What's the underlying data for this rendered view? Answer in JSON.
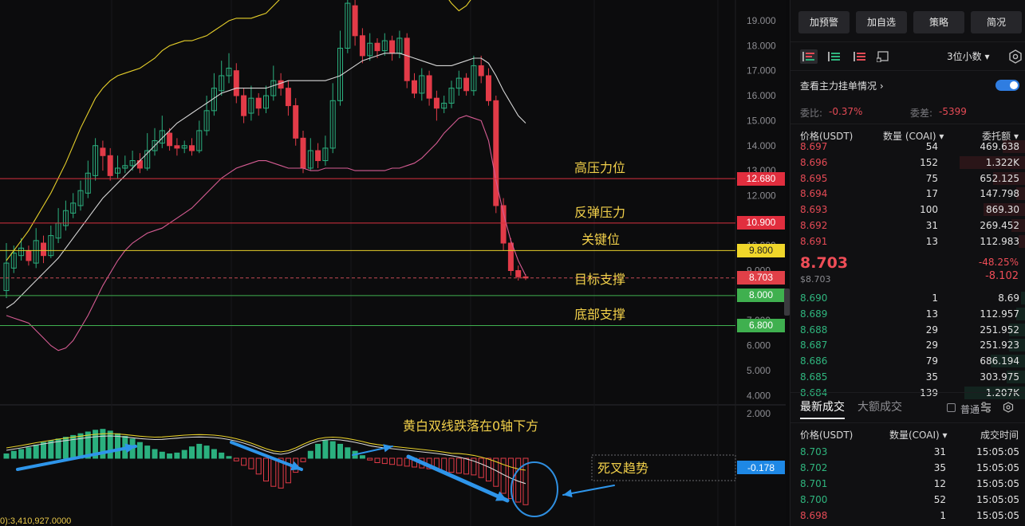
{
  "chart": {
    "price_axis": [
      "19.000",
      "18.000",
      "17.000",
      "16.000",
      "15.000",
      "14.000",
      "13.000",
      "12.000",
      "11.000",
      "10.000",
      "9.000",
      "8.000",
      "7.000",
      "6.000",
      "5.000",
      "4.000"
    ],
    "macd_axis": [
      "2.000"
    ],
    "levels": [
      {
        "value": "12.680",
        "color": "#e12e3e",
        "line": "#d8313f",
        "annotation": "高压力位"
      },
      {
        "value": "10.900",
        "color": "#e12e3e",
        "line": "#d8313f",
        "annotation": "反弹压力"
      },
      {
        "value": "9.800",
        "color": "#f0d62a",
        "line": "#e6cf2a",
        "annotation": "关键位"
      },
      {
        "value": "8.703",
        "color": "#e04048",
        "line": "#c44a54",
        "annotation": "目标支撑"
      },
      {
        "value": "8.000",
        "color": "#3fb04f",
        "line": "#3fb04f",
        "annotation": ""
      },
      {
        "value": "6.800",
        "color": "#3fb04f",
        "line": "#3fb04f",
        "annotation": "底部支撑"
      }
    ],
    "macd_value": "-0.178",
    "macd_annotation": "黄白双线跌落在0轴下方",
    "death_cross_annotation": "死叉趋势",
    "volume_caption": "0):3,410,927.0000",
    "colors": {
      "up": "#2bb07f",
      "down": "#e23b48",
      "macd_label": "#1e88e5"
    }
  },
  "panel": {
    "top_buttons": [
      "加预警",
      "加自选",
      "策略",
      "简况"
    ],
    "mode_icons": [
      "orderbook-both-icon",
      "orderbook-bids-icon",
      "orderbook-asks-icon",
      "orderbook-expand-icon"
    ],
    "decimal_select": "3位小数 ▾",
    "mainforce_link": "查看主力挂单情况 ›",
    "ratio_label": "委比:",
    "ratio_value": "-0.37%",
    "diff_label": "委差:",
    "diff_value": "-5399",
    "orderbook_headers": {
      "price": "价格(USDT)",
      "qty": "数量 (COAI) ▾",
      "amount": "委托额 ▾"
    },
    "asks": [
      {
        "price": "8.697",
        "qty": "54",
        "amount": "469.638",
        "depth": 0.1
      },
      {
        "price": "8.696",
        "qty": "152",
        "amount": "1.322K",
        "depth": 0.28
      },
      {
        "price": "8.695",
        "qty": "75",
        "amount": "652.125",
        "depth": 0.14
      },
      {
        "price": "8.694",
        "qty": "17",
        "amount": "147.798",
        "depth": 0.04
      },
      {
        "price": "8.693",
        "qty": "100",
        "amount": "869.30",
        "depth": 0.18
      },
      {
        "price": "8.692",
        "qty": "31",
        "amount": "269.452",
        "depth": 0.06
      },
      {
        "price": "8.691",
        "qty": "13",
        "amount": "112.983",
        "depth": 0.03
      }
    ],
    "last_price": "8.703",
    "last_price_usd": "$8.703",
    "change_pct": "-48.25%",
    "change_abs": "-8.102",
    "bids": [
      {
        "price": "8.690",
        "qty": "1",
        "amount": "8.69",
        "depth": 0.02
      },
      {
        "price": "8.689",
        "qty": "13",
        "amount": "112.957",
        "depth": 0.04
      },
      {
        "price": "8.688",
        "qty": "29",
        "amount": "251.952",
        "depth": 0.07
      },
      {
        "price": "8.687",
        "qty": "29",
        "amount": "251.923",
        "depth": 0.07
      },
      {
        "price": "8.686",
        "qty": "79",
        "amount": "686.194",
        "depth": 0.15
      },
      {
        "price": "8.685",
        "qty": "35",
        "amount": "303.975",
        "depth": 0.08
      },
      {
        "price": "8.684",
        "qty": "139",
        "amount": "1.207K",
        "depth": 0.26
      }
    ],
    "trade_tabs": [
      "最新成交",
      "大额成交"
    ],
    "normal_label": "普通",
    "trade_headers": {
      "price": "价格(USDT)",
      "qty": "数量(COAI) ▾",
      "time": "成交时间"
    },
    "trades": [
      {
        "price": "8.703",
        "qty": "31",
        "time": "15:05:05",
        "side": "buy"
      },
      {
        "price": "8.702",
        "qty": "35",
        "time": "15:05:05",
        "side": "buy"
      },
      {
        "price": "8.701",
        "qty": "12",
        "time": "15:05:05",
        "side": "buy"
      },
      {
        "price": "8.700",
        "qty": "52",
        "time": "15:05:05",
        "side": "buy"
      },
      {
        "price": "8.698",
        "qty": "1",
        "time": "15:05:05",
        "side": "sell"
      }
    ]
  }
}
